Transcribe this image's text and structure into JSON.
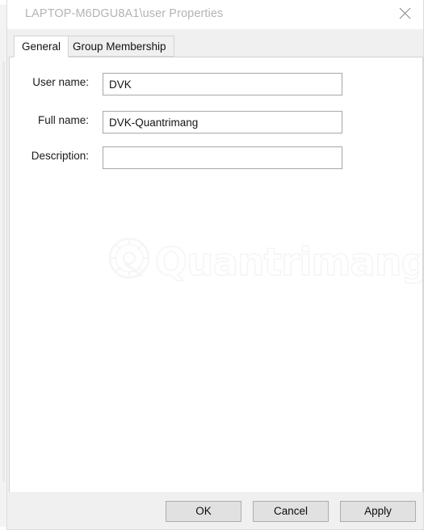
{
  "window": {
    "title": "LAPTOP-M6DGU8A1\\user Properties",
    "close_icon": "close-icon"
  },
  "tabs": [
    {
      "label": "General",
      "selected": true
    },
    {
      "label": "Group Membership",
      "selected": false
    }
  ],
  "general_tab": {
    "fields": [
      {
        "label": "User name:",
        "value": "DVK",
        "placeholder": ""
      },
      {
        "label": "Full name:",
        "value": "DVK-Quantrimang",
        "placeholder": ""
      },
      {
        "label": "Description:",
        "value": "",
        "placeholder": ""
      }
    ],
    "watermark": "Quantrimang"
  },
  "footer": {
    "ok_label": "OK",
    "cancel_label": "Cancel",
    "apply_label": "Apply"
  },
  "colors": {
    "dialog_background": "#f0f0f0",
    "panel_background": "#ffffff",
    "title_text": "#b4b4b4",
    "border": "#d3d3d3",
    "input_border": "#a8a8a8",
    "button_face": "#e1e1e1",
    "button_border": "#adadad",
    "watermark": "#f5f5f5"
  }
}
